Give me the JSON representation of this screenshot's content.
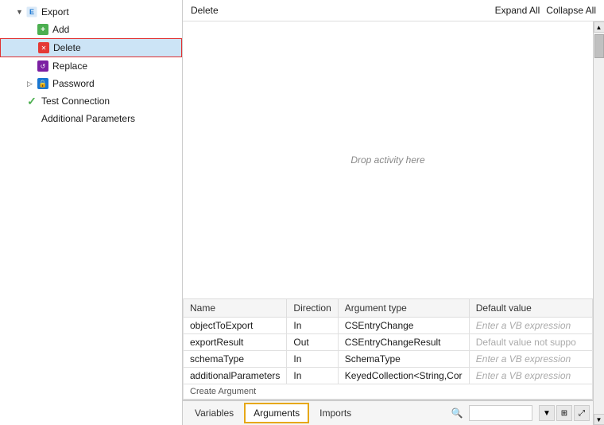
{
  "sidebar": {
    "items": [
      {
        "id": "export",
        "label": "Export",
        "indent": 0,
        "expander": "▼",
        "icon": "export"
      },
      {
        "id": "add",
        "label": "Add",
        "indent": 1,
        "expander": "",
        "icon": "add"
      },
      {
        "id": "delete",
        "label": "Delete",
        "indent": 1,
        "expander": "",
        "icon": "delete",
        "selected": true
      },
      {
        "id": "replace",
        "label": "Replace",
        "indent": 1,
        "expander": "",
        "icon": "replace"
      },
      {
        "id": "password",
        "label": "Password",
        "indent": 1,
        "expander": "▷",
        "icon": "password"
      },
      {
        "id": "test-connection",
        "label": "Test Connection",
        "indent": 0,
        "expander": "",
        "icon": "test"
      },
      {
        "id": "additional-parameters",
        "label": "Additional Parameters",
        "indent": 0,
        "expander": "",
        "icon": "none"
      }
    ]
  },
  "toolbar": {
    "delete_label": "Delete",
    "expand_all": "Expand All",
    "collapse_all": "Collapse All"
  },
  "content": {
    "drop_text": "Drop activity here"
  },
  "table": {
    "headers": [
      "Name",
      "Direction",
      "Argument type",
      "Default value"
    ],
    "rows": [
      {
        "name": "objectToExport",
        "direction": "In",
        "argtype": "CSEntryChange",
        "default": "Enter a VB expression",
        "default_placeholder": true
      },
      {
        "name": "exportResult",
        "direction": "Out",
        "argtype": "CSEntryChangeResult",
        "default": "Default value not suppo",
        "default_placeholder": false
      },
      {
        "name": "schemaType",
        "direction": "In",
        "argtype": "SchemaType",
        "default": "Enter a VB expression",
        "default_placeholder": true
      },
      {
        "name": "additionalParameters",
        "direction": "In",
        "argtype": "KeyedCollection<String,Cor",
        "default": "Enter a VB expression",
        "default_placeholder": true
      }
    ],
    "create_arg": "Create Argument"
  },
  "tabs": {
    "items": [
      {
        "id": "variables",
        "label": "Variables",
        "active": false
      },
      {
        "id": "arguments",
        "label": "Arguments",
        "active": true
      },
      {
        "id": "imports",
        "label": "Imports",
        "active": false
      }
    ],
    "search_placeholder": ""
  }
}
